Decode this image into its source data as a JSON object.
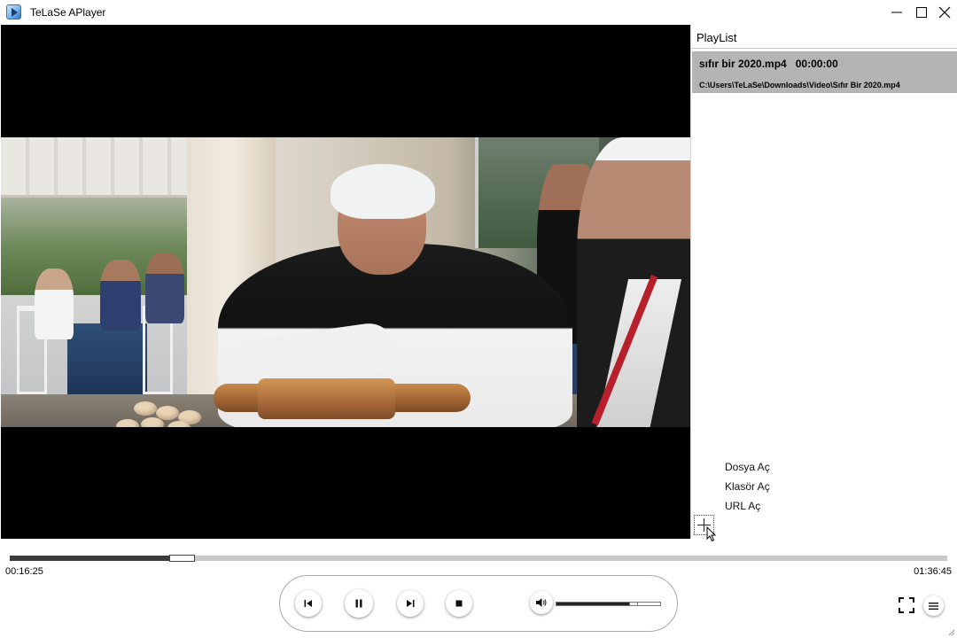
{
  "window": {
    "title": "TeLaSe APlayer",
    "controls": [
      "minimize",
      "maximize",
      "close"
    ]
  },
  "playlist": {
    "header": "PlayList",
    "items": [
      {
        "name": "sıfır bir 2020.mp4",
        "duration": "00:00:00",
        "path": "C:\\Users\\TeLaSe\\Downloads\\Video\\Sıfır Bir 2020.mp4",
        "selected": true
      }
    ],
    "menu": [
      "Dosya Aç",
      "Klasör Aç",
      "URL Aç"
    ],
    "add_button_icon": "plus-icon"
  },
  "player": {
    "current_time": "00:16:25",
    "total_time": "01:36:45",
    "progress_percent": 17,
    "volume_percent": 72,
    "state": "playing",
    "controls": [
      "previous-icon",
      "pause-icon",
      "next-icon",
      "stop-icon",
      "volume-icon",
      "fullscreen-icon",
      "menu-icon"
    ]
  },
  "colors": {
    "selected_item_bg": "#b4b4b4",
    "progress_fill": "#3a3a3a",
    "progress_track": "#c8c8c8",
    "video_bg": "#000000"
  }
}
